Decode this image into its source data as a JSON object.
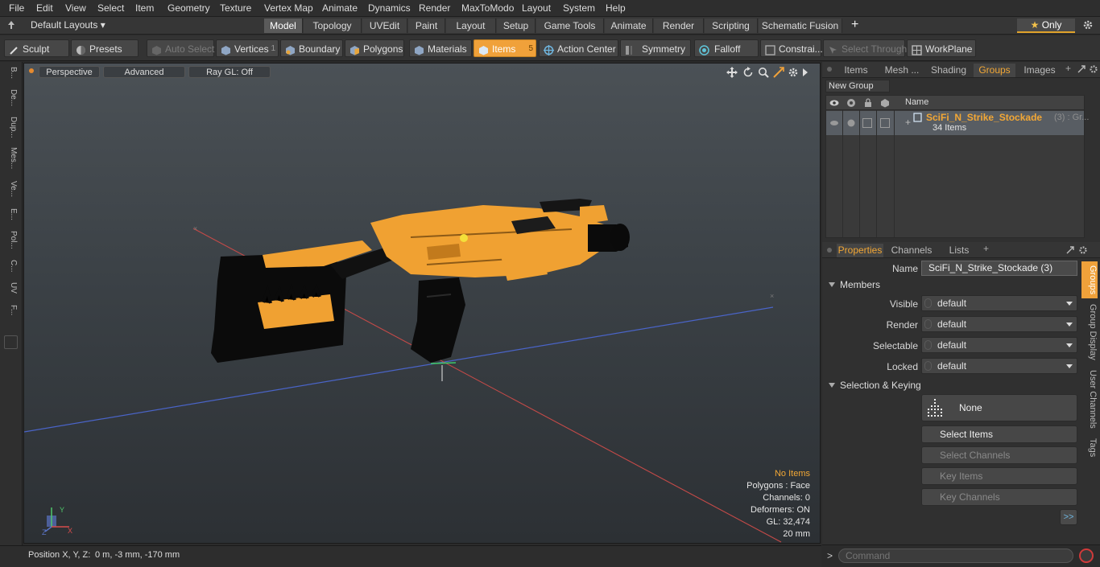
{
  "menu": [
    "File",
    "Edit",
    "View",
    "Select",
    "Item",
    "Geometry",
    "Texture",
    "Vertex Map",
    "Animate",
    "Dynamics",
    "Render",
    "MaxToModo",
    "Layout",
    "System",
    "Help"
  ],
  "layouts": {
    "dropdown": "Default Layouts",
    "tabs": [
      "Model",
      "Topology",
      "UVEdit",
      "Paint",
      "Layout",
      "Setup",
      "Game Tools",
      "Animate",
      "Render",
      "Scripting",
      "Schematic Fusion"
    ],
    "active": "Model",
    "only": "Only",
    "plus": "+"
  },
  "toolbar": {
    "sculpt": "Sculpt",
    "presets": "Presets",
    "auto_select": "Auto Select",
    "vertices": "Vertices",
    "vertices_count": "1",
    "boundary": "Boundary",
    "polygons": "Polygons",
    "materials": "Materials",
    "items": "Items",
    "items_count": "5",
    "action_center": "Action Center",
    "symmetry": "Symmetry",
    "falloff": "Falloff",
    "constraints": "Constrai...",
    "select_through": "Select Through",
    "workplane": "WorkPlane"
  },
  "left_tools": [
    "B...",
    "De...",
    "Dup...",
    "Mes...",
    "Ve...",
    "E...",
    "Pol...",
    "C...",
    "UV",
    "F..."
  ],
  "viewport": {
    "view": "Perspective",
    "shading": "Advanced",
    "raygl": "Ray GL: Off",
    "stats": {
      "items": "No Items",
      "polygons": "Polygons : Face",
      "channels": "Channels: 0",
      "deformers": "Deformers: ON",
      "gl": "GL: 32,474",
      "scale": "20 mm"
    },
    "axis_y": "Y",
    "axis_x": "X",
    "axis_z": "Z"
  },
  "status": {
    "label": "Position X, Y, Z:",
    "value": "0 m, -3 mm, -170 mm"
  },
  "right": {
    "tabs": [
      "Items",
      "Mesh ...",
      "Shading",
      "Groups",
      "Images"
    ],
    "active_tab": "Groups",
    "new_group": "New Group",
    "col_name": "Name",
    "group": {
      "name": "SciFi_N_Strike_Stockade",
      "suffix": "(3) : Gr...",
      "count": "34 Items"
    },
    "prop_tabs": [
      "Properties",
      "Channels",
      "Lists"
    ],
    "prop_active": "Properties",
    "name_label": "Name",
    "name_value": "SciFi_N_Strike_Stockade (3)",
    "members": "Members",
    "visible_label": "Visible",
    "visible": "default",
    "render_label": "Render",
    "render": "default",
    "selectable_label": "Selectable",
    "selectable": "default",
    "locked_label": "Locked",
    "locked": "default",
    "sel_keying": "Selection & Keying",
    "none": "None",
    "select_items": "Select Items",
    "select_channels": "Select Channels",
    "key_items": "Key Items",
    "key_channels": "Key Channels",
    "more": ">>",
    "side_tabs": [
      "Groups",
      "Group Display",
      "User Channels",
      "Tags"
    ],
    "command_placeholder": "Command",
    "prompt": ">"
  },
  "colors": {
    "accent": "#f2a735",
    "gun_orange": "#f0a132",
    "viewport_top": "#4b5156",
    "viewport_bottom": "#2c3034"
  }
}
